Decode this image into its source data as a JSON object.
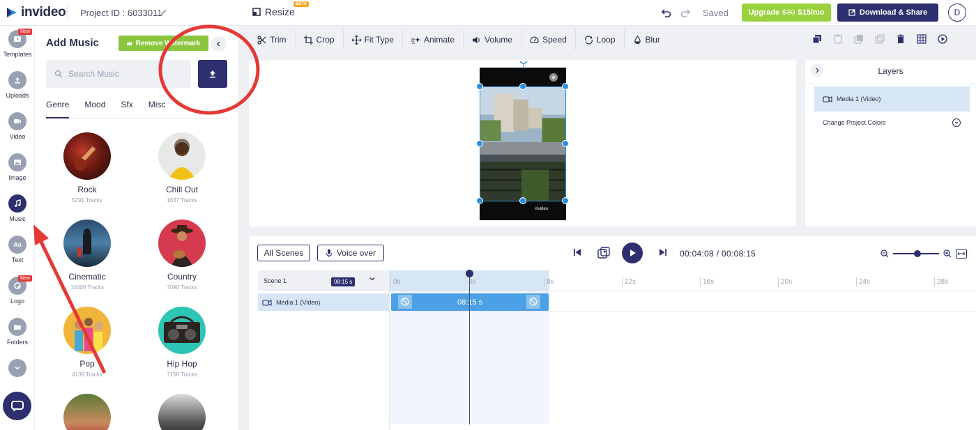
{
  "app": {
    "logo_text": "invideo",
    "project_id": "Project ID : 6033011",
    "resize_label": "Resize",
    "beta_badge": "BETA",
    "saved_status": "Saved",
    "upgrade": {
      "label": "Upgrade",
      "old_price": "$30",
      "new_price": "$15/mo"
    },
    "download_label": "Download & Share",
    "avatar_initial": "D"
  },
  "rail": {
    "items": [
      {
        "label": "Templates",
        "icon": "templates-icon",
        "badge": "New"
      },
      {
        "label": "Uploads",
        "icon": "upload-icon"
      },
      {
        "label": "Video",
        "icon": "video-icon"
      },
      {
        "label": "Image",
        "icon": "image-icon"
      },
      {
        "label": "Music",
        "icon": "music-icon",
        "active": true
      },
      {
        "label": "Text",
        "icon": "text-icon",
        "glyph": "Aa"
      },
      {
        "label": "Logo",
        "icon": "logo-icon",
        "badge": "New"
      },
      {
        "label": "Folders",
        "icon": "folder-icon"
      }
    ]
  },
  "music_panel": {
    "title": "Add Music",
    "remove_watermark": "Remove Watermark",
    "search_placeholder": "Search Music",
    "tabs": [
      "Genre",
      "Mood",
      "Sfx",
      "Misc"
    ],
    "genres": [
      {
        "name": "Rock",
        "count": "5291 Tracks"
      },
      {
        "name": "Chill Out",
        "count": "1637 Tracks"
      },
      {
        "name": "Cinematic",
        "count": "10000 Tracks"
      },
      {
        "name": "Country",
        "count": "7090 Tracks"
      },
      {
        "name": "Pop",
        "count": "4139 Tracks"
      },
      {
        "name": "Hip Hop",
        "count": "7156 Tracks"
      }
    ]
  },
  "toolbar": {
    "items": [
      "Trim",
      "Crop",
      "Fit Type",
      "Animate",
      "Volume",
      "Speed",
      "Loop",
      "Blur"
    ]
  },
  "canvas": {
    "watermark": "invideo"
  },
  "layers": {
    "title": "Layers",
    "items": [
      "Media 1 (Video)"
    ],
    "change_colors": "Change Project Colors"
  },
  "timeline": {
    "all_scenes": "All Scenes",
    "voice_over": "Voice over",
    "current_time": "00:04:08",
    "separator": "/",
    "total_time": "00:08:15",
    "scene_label": "Scene 1",
    "scene_duration": "08:15 s",
    "media_label": "Media 1 (Video)",
    "clip_label": "08:15 s",
    "ticks": [
      "0s",
      "4s",
      "8s",
      "12s",
      "16s",
      "20s",
      "24s",
      "28s"
    ]
  },
  "colors": {
    "brand": "#2d2f6e",
    "upgrade_green": "#9ad13e",
    "watermark_green": "#8bc53f",
    "clip_blue": "#4ba0e6",
    "annotation_red": "#e53935"
  }
}
